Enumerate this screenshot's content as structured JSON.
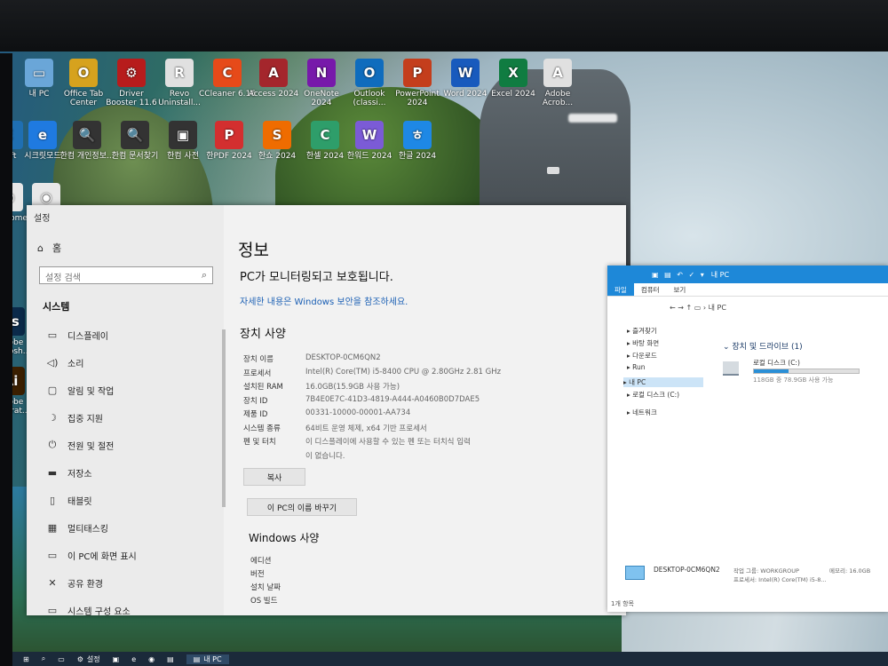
{
  "desktop": {
    "icons": [
      {
        "label": "내 PC",
        "color": "#6aa6d8",
        "glyph": "▭"
      },
      {
        "label": "Office Tab Center",
        "color": "#d6a21e",
        "glyph": "O"
      },
      {
        "label": "Driver Booster 11.6",
        "color": "#b71c1c",
        "glyph": "⚙"
      },
      {
        "label": "Revo Uninstall...",
        "color": "#e0e0e0",
        "glyph": "R"
      },
      {
        "label": "CCleaner 6.16",
        "color": "#e64a19",
        "glyph": "C"
      },
      {
        "label": "Access 2024",
        "color": "#a4262c",
        "glyph": "A"
      },
      {
        "label": "OneNote 2024",
        "color": "#7719aa",
        "glyph": "N"
      },
      {
        "label": "Outlook (classi...",
        "color": "#0f6cbd",
        "glyph": "O"
      },
      {
        "label": "PowerPoint 2024",
        "color": "#c43e1c",
        "glyph": "P"
      },
      {
        "label": "Word 2024",
        "color": "#185abd",
        "glyph": "W"
      },
      {
        "label": "Excel 2024",
        "color": "#107c41",
        "glyph": "X"
      },
      {
        "label": "Adobe Acrob...",
        "color": "#e0e0e0",
        "glyph": "A"
      },
      {
        "label": "soft",
        "color": "#1f6fb2",
        "glyph": "E"
      },
      {
        "label": "시크릿모드",
        "color": "#1f7ae0",
        "glyph": "e"
      },
      {
        "label": "한컴 개인정보...",
        "color": "#333333",
        "glyph": "🔍"
      },
      {
        "label": "한컴 문서찾기",
        "color": "#333333",
        "glyph": "🔍"
      },
      {
        "label": "한컴 사전",
        "color": "#333333",
        "glyph": "▣"
      },
      {
        "label": "한PDF 2024",
        "color": "#d32f2f",
        "glyph": "P"
      },
      {
        "label": "한쇼 2024",
        "color": "#ef6c00",
        "glyph": "S"
      },
      {
        "label": "한셀 2024",
        "color": "#2e9e6a",
        "glyph": "C"
      },
      {
        "label": "한워드 2024",
        "color": "#7b5bd6",
        "glyph": "W"
      },
      {
        "label": "한글 2024",
        "color": "#1e88e5",
        "glyph": "ㅎ"
      },
      {
        "label": "ogle ome",
        "color": "#e8e8e8",
        "glyph": "◉"
      },
      {
        "label": "Chrome",
        "color": "#e8e8e8",
        "glyph": "◉"
      },
      {
        "label": "Adobe Photosh...",
        "color": "#0b2a4a",
        "glyph": "Ps"
      },
      {
        "label": "Adobe Illustrat...",
        "color": "#3b1f00",
        "glyph": "Ai"
      }
    ]
  },
  "settings": {
    "window_title": "설정",
    "home": "홈",
    "search_placeholder": "설정 검색",
    "section": "시스템",
    "nav": [
      {
        "icon": "▭",
        "label": "디스플레이"
      },
      {
        "icon": "◁)",
        "label": "소리"
      },
      {
        "icon": "▢",
        "label": "알림 및 작업"
      },
      {
        "icon": "☽",
        "label": "집중 지원"
      },
      {
        "icon": "⏻",
        "label": "전원 및 절전"
      },
      {
        "icon": "▬",
        "label": "저장소"
      },
      {
        "icon": "▯",
        "label": "태블릿"
      },
      {
        "icon": "▦",
        "label": "멀티태스킹"
      },
      {
        "icon": "▭",
        "label": "이 PC에 화면 표시"
      },
      {
        "icon": "✕",
        "label": "공유 환경"
      },
      {
        "icon": "▭",
        "label": "시스템 구성 요소"
      }
    ],
    "page_title": "정보",
    "protect_text": "PC가 모니터링되고 보호됩니다.",
    "link": "자세한 내용은 Windows 보안을 참조하세요.",
    "device_spec_title": "장치 사양",
    "specs": [
      {
        "k": "장치 이름",
        "v": "DESKTOP-0CM6QN2"
      },
      {
        "k": "프로세서",
        "v": "Intel(R) Core(TM) i5-8400 CPU @ 2.80GHz   2.81 GHz"
      },
      {
        "k": "설치된 RAM",
        "v": "16.0GB(15.9GB 사용 가능)"
      },
      {
        "k": "장치 ID",
        "v": "7B4E0E7C-41D3-4819-A444-A0460B0D7DAE5"
      },
      {
        "k": "제품 ID",
        "v": "00331-10000-00001-AA734"
      },
      {
        "k": "시스템 종류",
        "v": "64비트 운영 체제, x64 기반 프로세서"
      },
      {
        "k": "펜 및 터치",
        "v": "이 디스플레이에 사용할 수 있는 펜 또는 터치식 입력"
      },
      {
        "k": "",
        "v": "이 없습니다."
      }
    ],
    "copy_btn": "복사",
    "rename_btn": "이 PC의 이름 바꾸기",
    "windows_spec_title": "Windows 사양",
    "win_rows": [
      "에디션",
      "버전",
      "설치 날짜",
      "OS 빌드"
    ]
  },
  "explorer": {
    "title": "내 PC",
    "tabs": [
      "파일",
      "컴퓨터",
      "보기"
    ],
    "address": "내 PC",
    "nav": [
      "즐겨찾기",
      "바탕 화면",
      "다운로드",
      "Run",
      "내 PC",
      "로컬 디스크 (C:)",
      "네트워크"
    ],
    "group": "장치 및 드라이브 (1)",
    "drive_name": "로컬 디스크 (C:)",
    "drive_used_pct": 0.33,
    "drive_free": "118GB 중 78.9GB 사용 가능",
    "status_name": "DESKTOP-0CM6QN2",
    "status_wg": "작업 그룹: WORKGROUP",
    "status_proc": "프로세서: Intel(R) Core(TM) i5-8...",
    "status_mem": "메모리: 16.0GB",
    "item_count": "1개 항목"
  },
  "taskbar": {
    "settings": "설정",
    "explorer": "내 PC"
  }
}
